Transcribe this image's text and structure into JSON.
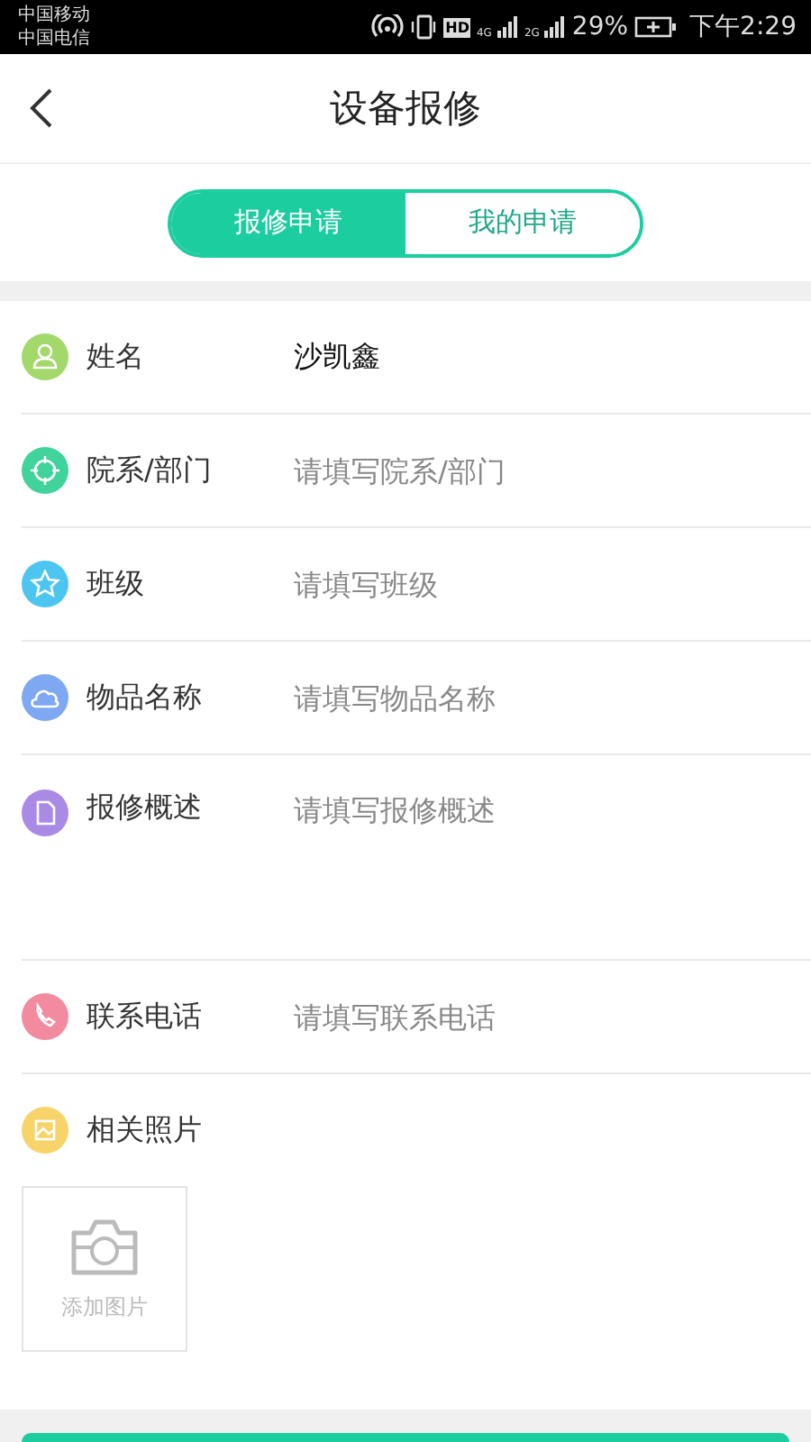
{
  "status_bar": {
    "carriers": [
      "中国移动",
      "中国电信"
    ],
    "hd": "HD",
    "net_1": "4G",
    "net_2": "2G",
    "battery_text": "29%",
    "time": "下午2:29"
  },
  "header": {
    "title": "设备报修"
  },
  "tabs": [
    {
      "label": "报修申请",
      "selected": true
    },
    {
      "label": "我的申请",
      "selected": false
    }
  ],
  "fields": [
    {
      "kind": "input",
      "label": "姓名",
      "value": "沙凯鑫",
      "color": "#a3d86a"
    },
    {
      "kind": "input",
      "label": "院系/部门",
      "placeholder": "请填写院系/部门",
      "color": "#40d39c"
    },
    {
      "kind": "input",
      "label": "班级",
      "placeholder": "请填写班级",
      "color": "#4cc6f0"
    },
    {
      "kind": "input",
      "label": "物品名称",
      "placeholder": "请填写物品名称",
      "color": "#7fa8f2"
    },
    {
      "kind": "textarea",
      "label": "报修概述",
      "placeholder": "请填写报修概述",
      "color": "#a98be6"
    },
    {
      "kind": "input",
      "label": "联系电话",
      "placeholder": "请填写联系电话",
      "color": "#f28aa0"
    },
    {
      "kind": "photos",
      "label": "相关照片",
      "color": "#f7d46a",
      "add_label": "添加图片"
    }
  ]
}
